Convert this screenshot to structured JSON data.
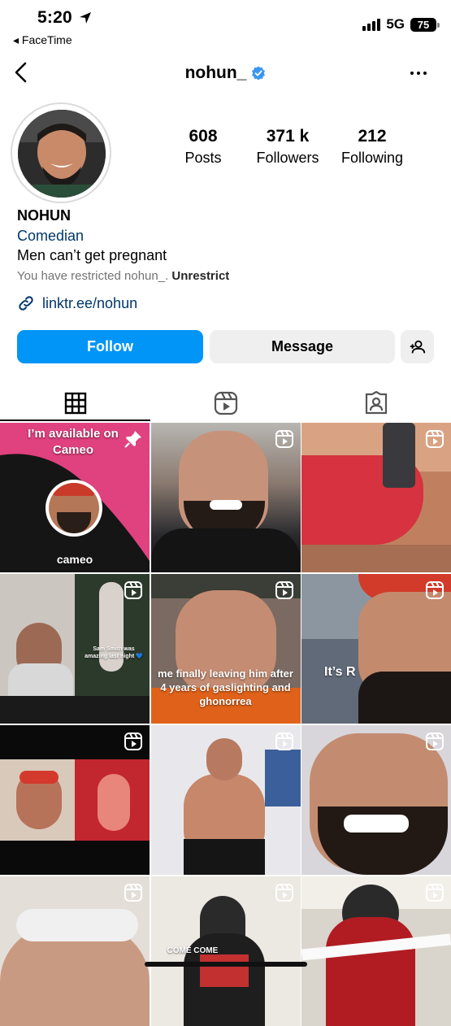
{
  "status_bar": {
    "time": "5:20",
    "back_app": "◂ FaceTime",
    "network": "5G",
    "battery": "75"
  },
  "header": {
    "username": "nohun_",
    "verified": true
  },
  "profile": {
    "stats": [
      {
        "value": "608",
        "label": "Posts"
      },
      {
        "value": "371 k",
        "label": "Followers"
      },
      {
        "value": "212",
        "label": "Following"
      }
    ],
    "name": "NOHUN",
    "category": "Comedian",
    "bio": "Men can’t get pregnant",
    "restricted_text": "You have restricted nohun_.",
    "unrestrict_label": "Unrestrict",
    "link": "linktr.ee/nohun"
  },
  "actions": {
    "follow_label": "Follow",
    "message_label": "Message"
  },
  "tabs": [
    "grid-icon",
    "reels-icon",
    "tagged-icon"
  ],
  "grid": {
    "posts": [
      {
        "type": "pinned",
        "text_top": "I’m available on Cameo",
        "text_bottom": "cameo"
      },
      {
        "type": "reel"
      },
      {
        "type": "reel"
      },
      {
        "type": "reel",
        "caption": "Sam Smith was amazing last night 💙"
      },
      {
        "type": "reel",
        "caption": "me finally leaving him after 4 years of gaslighting and ghonorrea"
      },
      {
        "type": "reel",
        "caption": "It’s R"
      },
      {
        "type": "reel"
      },
      {
        "type": "reel"
      },
      {
        "type": "reel"
      },
      {
        "type": "reel"
      },
      {
        "type": "reel",
        "caption": "COME COME"
      },
      {
        "type": "reel"
      }
    ]
  },
  "colors": {
    "accent": "#0095f6",
    "link": "#00376b",
    "verified": "#3897f0",
    "cameo_pink": "#e0417f"
  }
}
